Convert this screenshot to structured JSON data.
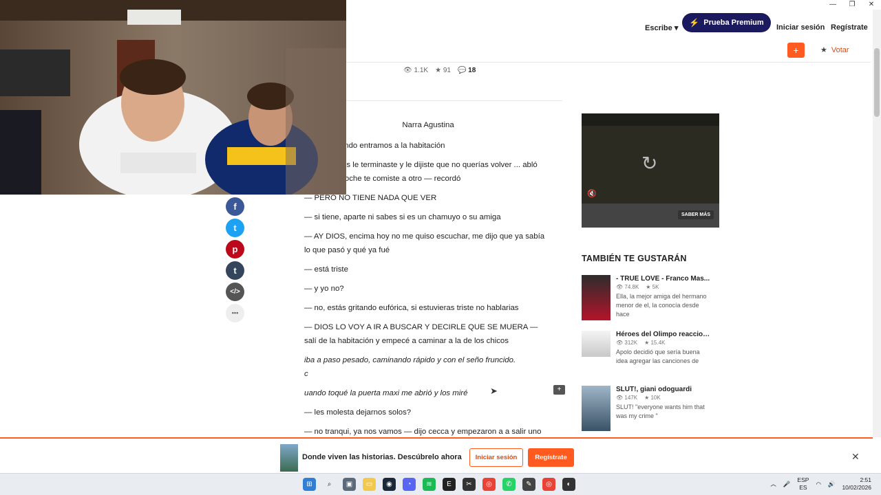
{
  "window": {
    "controls": [
      "—",
      "❐",
      "✕"
    ]
  },
  "nav": {
    "write": "Escribe",
    "premium": "Prueba Premium",
    "login": "Iniciar sesión",
    "signup": "Regístrate"
  },
  "subbar": {
    "add": "+",
    "vote": "Votar"
  },
  "stats": {
    "reads": "1.1K",
    "votes": "91",
    "comments": "18"
  },
  "story": {
    "paragraphs": [
      {
        "text": "Narra Agustina",
        "style": "center"
      },
      {
        "text": "— grité cuando entramos a la habitación",
        "style": ""
      },
      {
        "text": "e enojas, vos le terminaste y le dijiste que no querías volver ... abló Sofi — y anoche te comiste a otro — recordó",
        "style": ""
      },
      {
        "text": "— PERO NO TIENE NADA QUE VER",
        "style": ""
      },
      {
        "text": "— si tiene, aparte ni sabes si es un chamuyo o su amiga",
        "style": ""
      },
      {
        "text": "— AY DIOS, encima hoy no me quiso escuchar, me dijo que ya sabía lo que pasó y qué ya fué",
        "style": ""
      },
      {
        "text": "— está triste",
        "style": ""
      },
      {
        "text": "— y yo no?",
        "style": ""
      },
      {
        "text": "— no, estás gritando eufórica, si estuvieras triste no hablarias",
        "style": ""
      },
      {
        "text": "— DIOS LO VOY A IR A BUSCAR Y DECIRLE QUE SE MUERA — salí de la habitación y empecé a caminar a la de los chicos",
        "style": ""
      },
      {
        "text": "iba a paso pesado, caminando rápido y con el seño fruncido.",
        "style": "italic tight"
      },
      {
        "text": "c",
        "style": "italic"
      },
      {
        "text": "uando toqué la puerta maxi me abrió y los miré",
        "style": "italic"
      },
      {
        "text": "— les molesta dejarnos solos?",
        "style": ""
      },
      {
        "text": "— no tranqui, ya nos vamos — dijo cecca y empezaron a a salir uno por",
        "style": ""
      }
    ]
  },
  "share": [
    "f",
    "t",
    "p",
    "t",
    "</>",
    "•••"
  ],
  "ad": {
    "more": "SABER MÁS",
    "replay": "↻",
    "mute": "🔇"
  },
  "recommendations": {
    "title": "TAMBIÉN TE GUSTARÁN",
    "items": [
      {
        "title": "- TRUE LOVE - Franco Mas...",
        "reads": "74.8K",
        "votes": "5K",
        "desc": "Ella, la mejor amiga del hermano menor de el, la conocía desde hace"
      },
      {
        "title": "Héroes del Olimpo reacciona...",
        "reads": "312K",
        "votes": "15.4K",
        "desc": "Apolo decidió que sería buena idea agregar las canciones de"
      },
      {
        "title": "SLUT!, giani odoguardi",
        "reads": "147K",
        "votes": "10K",
        "desc": "SLUT! \"everyone wants him that was my crime \""
      }
    ]
  },
  "banner": {
    "text": "Donde viven las historias. Descúbrelo ahora",
    "login": "Iniciar sesión",
    "signup": "Regístrate",
    "close": "✕"
  },
  "taskbar": {
    "lang1": "ESP",
    "lang2": "ES",
    "time": "2:51",
    "date": "10/02/2026"
  }
}
